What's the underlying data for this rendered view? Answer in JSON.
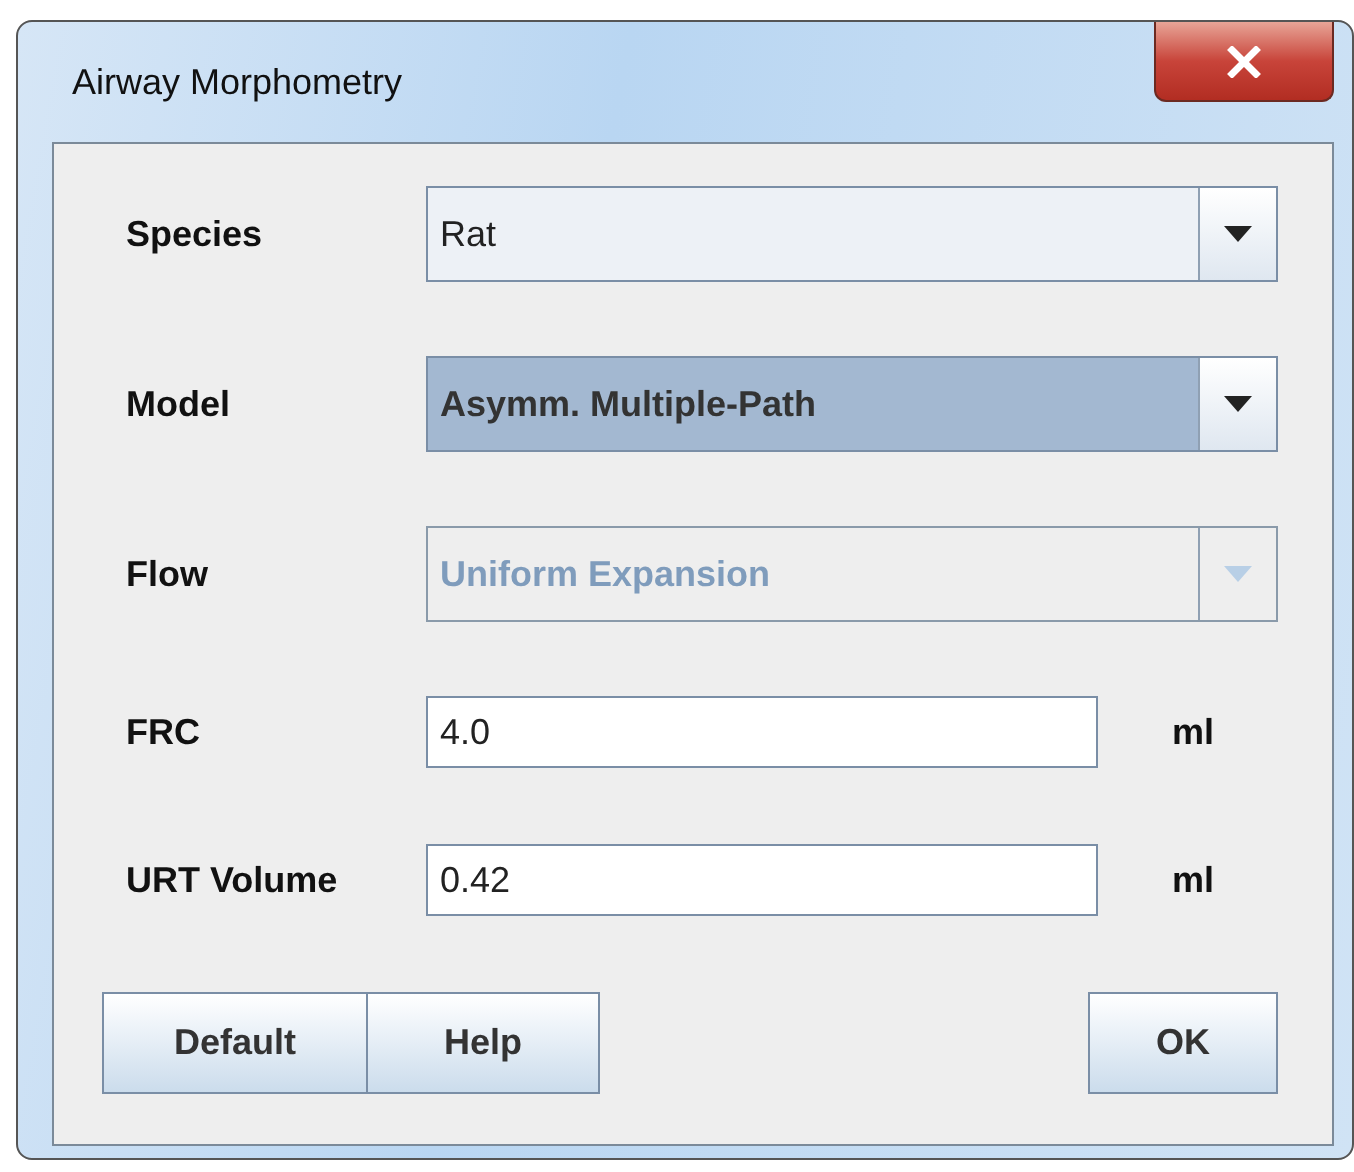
{
  "window": {
    "title": "Airway Morphometry"
  },
  "rows": [
    {
      "kind": "combo",
      "label": "Species",
      "value": "Rat",
      "highlighted": false,
      "disabled": false
    },
    {
      "kind": "combo",
      "label": "Model",
      "value": "Asymm. Multiple-Path",
      "highlighted": true,
      "disabled": false
    },
    {
      "kind": "combo",
      "label": "Flow",
      "value": "Uniform Expansion",
      "highlighted": false,
      "disabled": true
    },
    {
      "kind": "field",
      "label": "FRC",
      "value": "4.0",
      "unit": "ml"
    },
    {
      "kind": "field",
      "label": "URT Volume",
      "value": "0.42",
      "unit": "ml"
    }
  ],
  "buttons_left": [
    "Default",
    "Help"
  ],
  "buttons_right": [
    "OK"
  ]
}
